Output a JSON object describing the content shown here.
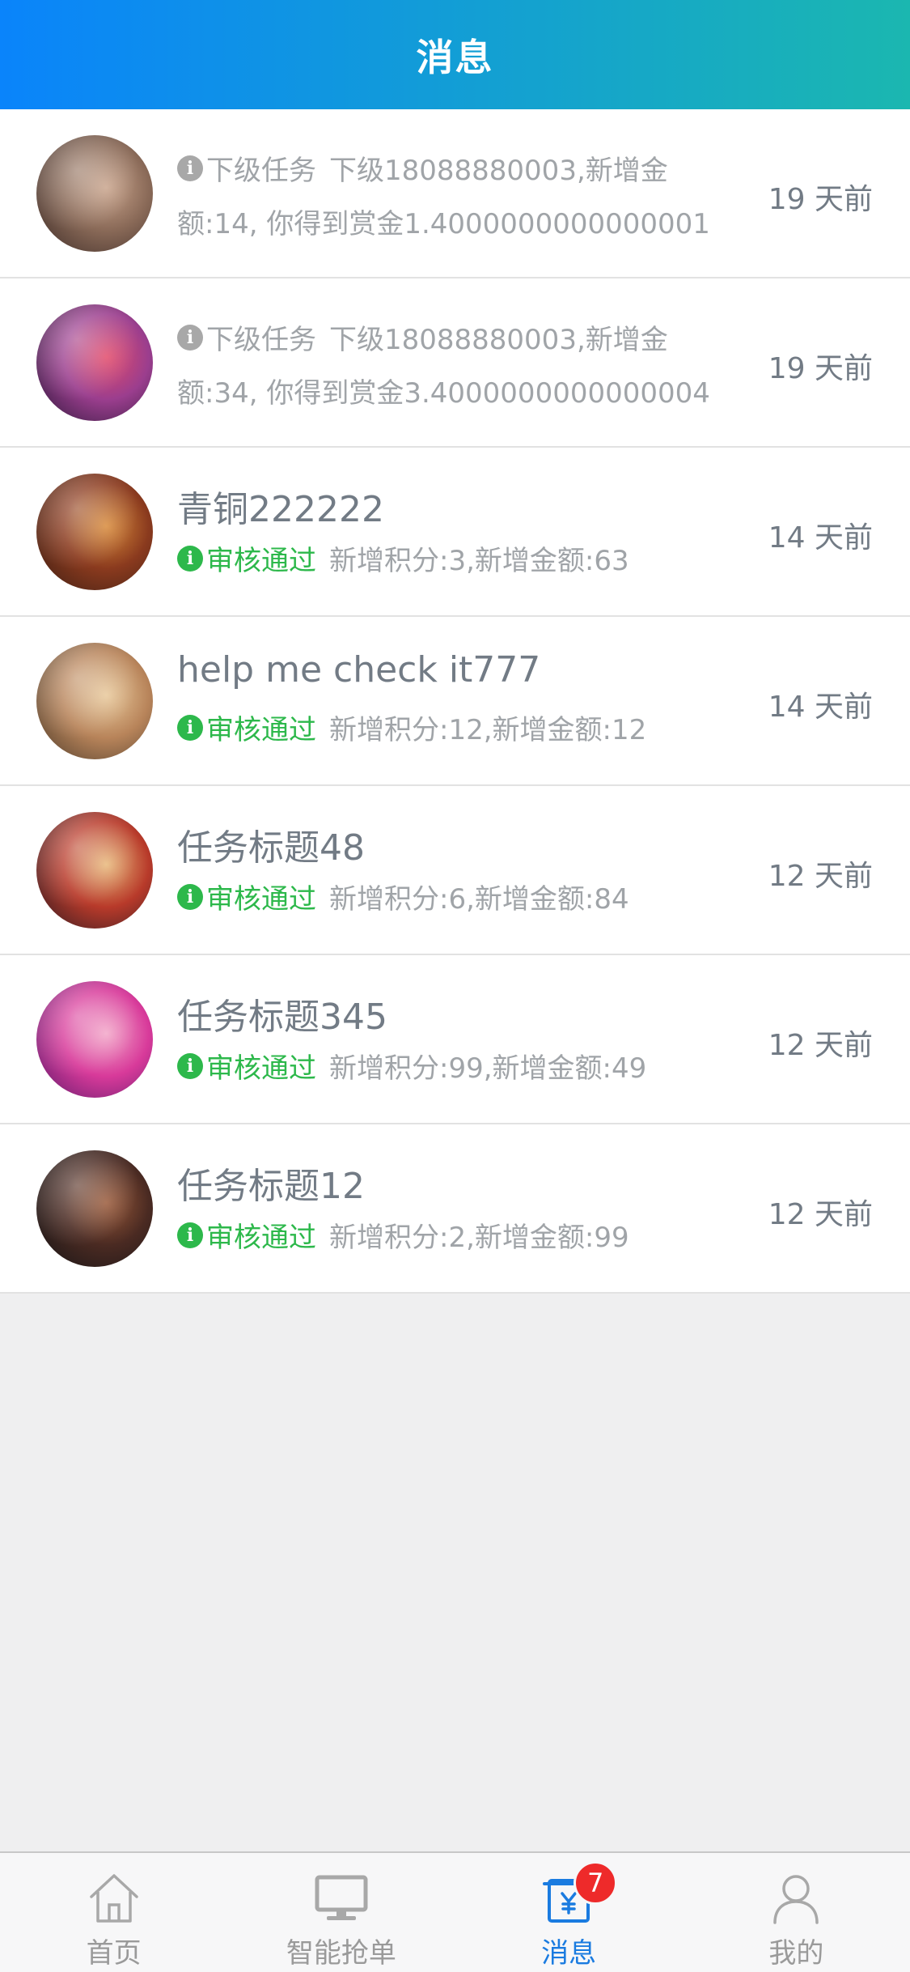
{
  "header": {
    "title": "消息"
  },
  "messages": [
    {
      "type": "system",
      "tag": "下级任务",
      "line1": "下级18088880003,新增金",
      "line2": "额:14, 你得到赏金1.4000000000000001",
      "time": "19 天前",
      "avatar_colors": [
        "#3a2a26",
        "#8a6a58",
        "#c9a48c"
      ]
    },
    {
      "type": "system",
      "tag": "下级任务",
      "line1": "下级18088880003,新增金",
      "line2": "额:34, 你得到赏金3.4000000000000004",
      "time": "19 天前",
      "avatar_colors": [
        "#2a1838",
        "#9b3e8e",
        "#e24a6a"
      ]
    },
    {
      "type": "task",
      "title": "青铜222222",
      "status": "审核通过",
      "detail": "新增积分:3,新增金额:63",
      "time": "14 天前",
      "avatar_colors": [
        "#3a1e14",
        "#8a3a1e",
        "#d88a3a"
      ]
    },
    {
      "type": "task",
      "title": "help me check it777",
      "status": "审核通过",
      "detail": "新增积分:12,新增金额:12",
      "time": "14 天前",
      "avatar_colors": [
        "#4a3a2a",
        "#b8845a",
        "#e8c89a"
      ]
    },
    {
      "type": "task",
      "title": "任务标题48",
      "status": "审核通过",
      "detail": "新增积分:6,新增金额:84",
      "time": "12 天前",
      "avatar_colors": [
        "#2a1a22",
        "#b83a2a",
        "#e8b87a"
      ]
    },
    {
      "type": "task",
      "title": "任务标题345",
      "status": "审核通过",
      "detail": "新增积分:99,新增金额:49",
      "time": "12 天前",
      "avatar_colors": [
        "#5a1a6a",
        "#d83a9a",
        "#f2a6c8"
      ]
    },
    {
      "type": "task",
      "title": "任务标题12",
      "status": "审核通过",
      "detail": "新增积分:2,新增金额:99",
      "time": "12 天前",
      "avatar_colors": [
        "#141416",
        "#4a2a22",
        "#9a5a3a"
      ]
    }
  ],
  "tabbar": {
    "items": [
      {
        "label": "首页",
        "icon": "home-icon",
        "active": false
      },
      {
        "label": "智能抢单",
        "icon": "monitor-icon",
        "active": false
      },
      {
        "label": "消息",
        "icon": "yen-message-icon",
        "active": true,
        "badge": "7"
      },
      {
        "label": "我的",
        "icon": "user-icon",
        "active": false
      }
    ]
  },
  "colors": {
    "header_gradient_start": "#0a84fb",
    "header_gradient_end": "#1bb7b0",
    "status_green": "#2db84b",
    "active_tab": "#1a7be0",
    "badge_red": "#ee2a2a"
  }
}
